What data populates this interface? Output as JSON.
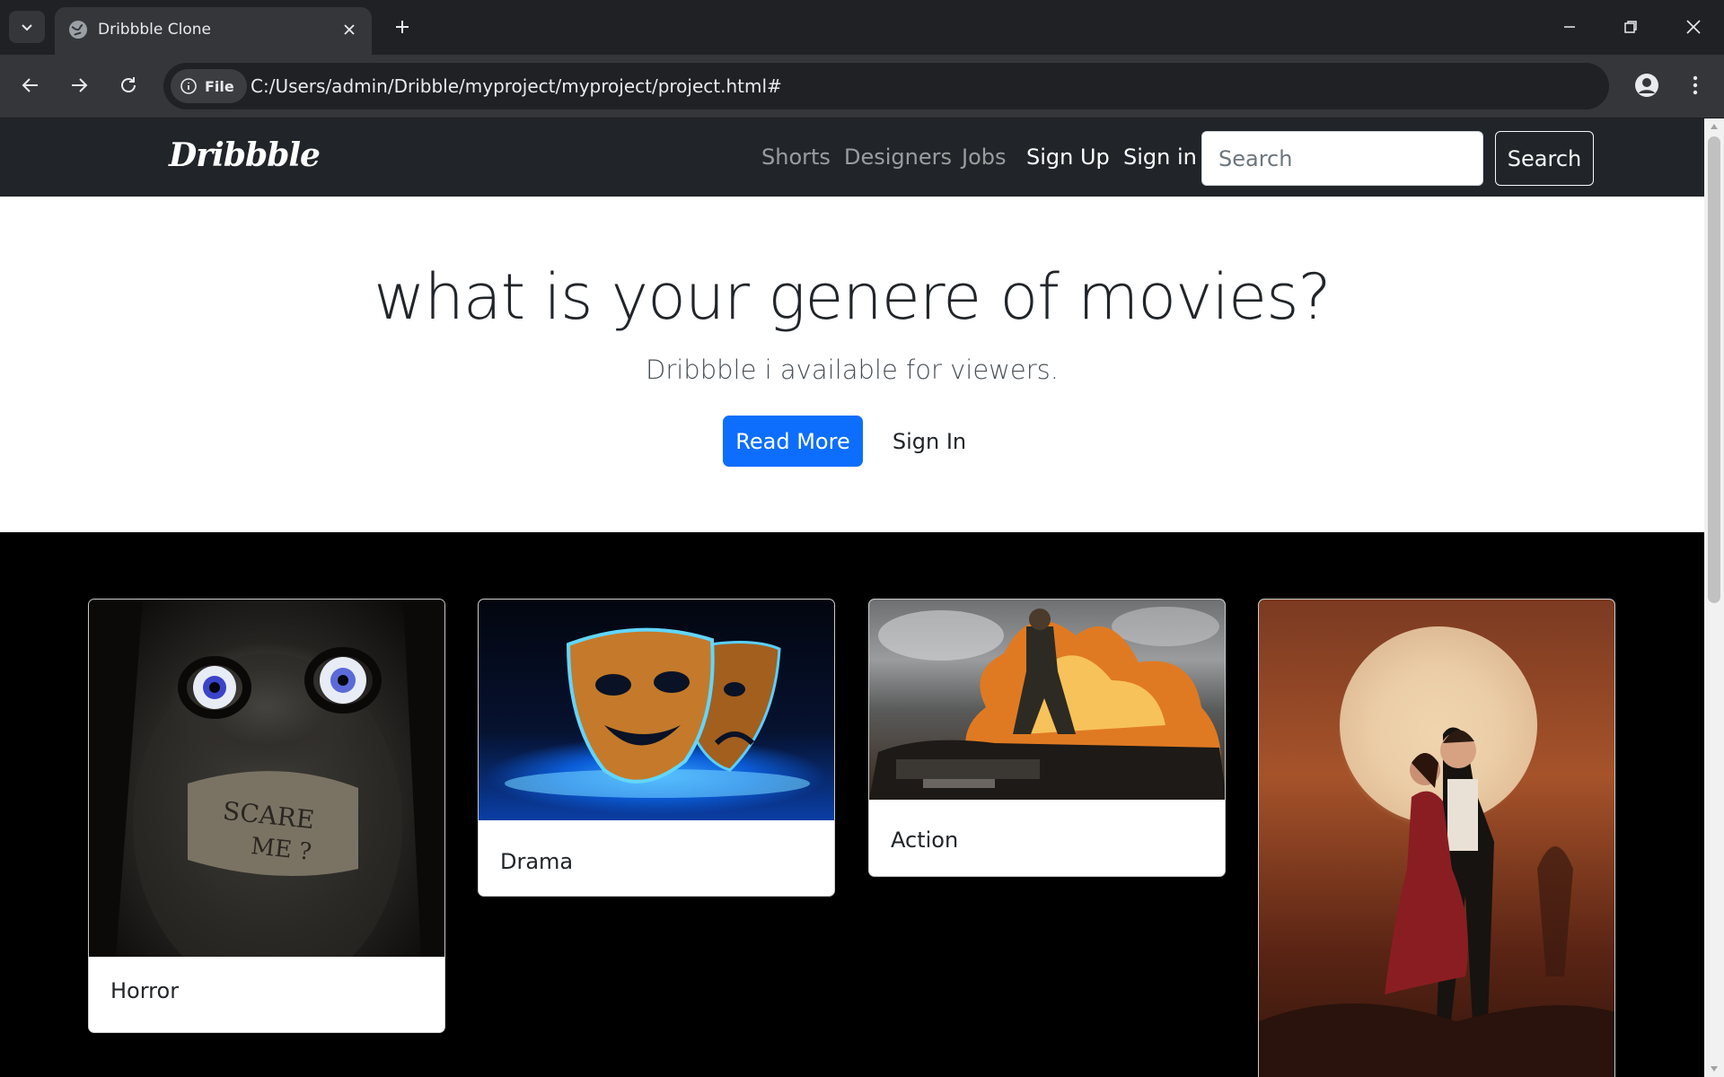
{
  "browser": {
    "tab_title": "Dribbble Clone",
    "site_chip_label": "File",
    "url": "C:/Users/admin/Dribble/myproject/myproject/project.html#"
  },
  "site": {
    "brand": "Dribbble",
    "nav": {
      "shorts": "Shorts",
      "designers": "Designers",
      "jobs": "Jobs",
      "sign_up": "Sign Up",
      "sign_in": "Sign in"
    },
    "search": {
      "placeholder": "Search",
      "button": "Search"
    }
  },
  "hero": {
    "title": "what is your genere of movies?",
    "subtitle": "Dribbble i available for viewers.",
    "primary_button": "Read More",
    "secondary_button": "Sign In"
  },
  "cards": [
    {
      "title": "Horror",
      "image_icon": "horror-image"
    },
    {
      "title": "Drama",
      "image_icon": "drama-masks-image"
    },
    {
      "title": "Action",
      "image_icon": "action-explosion-image"
    },
    {
      "title": "",
      "image_icon": "romance-couple-image"
    }
  ],
  "colors": {
    "navbar_bg": "#212529",
    "primary": "#0d6efd",
    "page_bg": "#000000"
  }
}
